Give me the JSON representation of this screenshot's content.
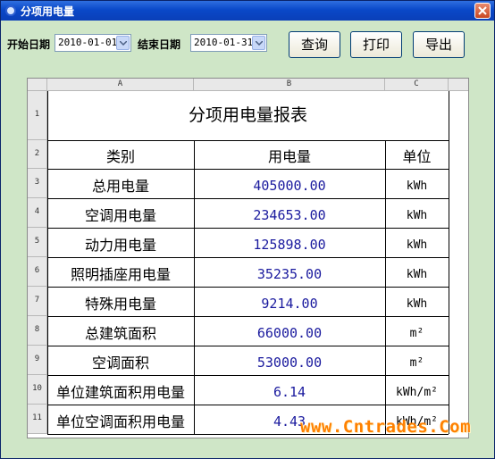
{
  "window": {
    "title": "分项用电量"
  },
  "filters": {
    "start_label": "开始日期",
    "start_value": "2010-01-01",
    "end_label": "结束日期",
    "end_value": "2010-01-31"
  },
  "toolbar": {
    "query_label": "查询",
    "print_label": "打印",
    "export_label": "导出"
  },
  "sheet": {
    "columns": [
      "A",
      "B",
      "C"
    ],
    "row_numbers": [
      "1",
      "2",
      "3",
      "4",
      "5",
      "6",
      "7",
      "8",
      "9",
      "10",
      "11"
    ],
    "report_title": "分项用电量报表",
    "header": {
      "category": "类别",
      "value": "用电量",
      "unit": "单位"
    },
    "rows": [
      {
        "category": "总用电量",
        "value": "405000.00",
        "unit": "kWh"
      },
      {
        "category": "空调用电量",
        "value": "234653.00",
        "unit": "kWh"
      },
      {
        "category": "动力用电量",
        "value": "125898.00",
        "unit": "kWh"
      },
      {
        "category": "照明插座用电量",
        "value": "35235.00",
        "unit": "kWh"
      },
      {
        "category": "特殊用电量",
        "value": "9214.00",
        "unit": "kWh"
      },
      {
        "category": "总建筑面积",
        "value": "66000.00",
        "unit": "m²"
      },
      {
        "category": "空调面积",
        "value": "53000.00",
        "unit": "m²"
      },
      {
        "category": "单位建筑面积用电量",
        "value": "6.14",
        "unit": "kWh/m²"
      },
      {
        "category": "单位空调面积用电量",
        "value": "4.43",
        "unit": "kWh/m²"
      }
    ]
  },
  "watermark": "www.Cntrades.Com",
  "colors": {
    "titlebar": "#0a48c8",
    "background": "#cfe6c7",
    "value_text": "#1a1a9e",
    "watermark": "#ff8000"
  }
}
